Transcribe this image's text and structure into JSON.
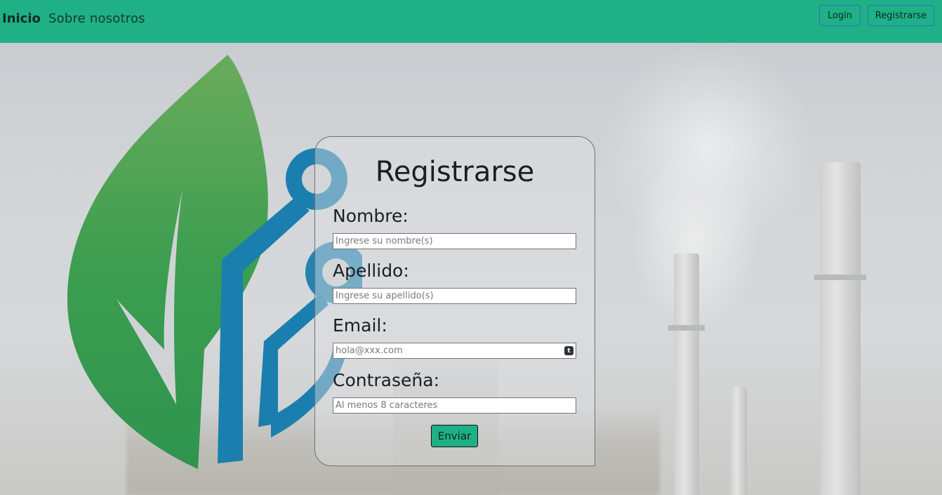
{
  "navbar": {
    "brand": "Inicio",
    "about_link": "Sobre nosotros",
    "login_label": "Login",
    "register_label": "Registrarse",
    "bg_color": "#1fb085"
  },
  "form": {
    "title": "Registrarse",
    "fields": [
      {
        "label": "Nombre:",
        "placeholder": "Ingrese su nombre(s)",
        "value": ""
      },
      {
        "label": "Apellido:",
        "placeholder": "Ingrese su apellido(s)",
        "value": ""
      },
      {
        "label": "Email:",
        "placeholder": "hola@xxx.com",
        "value": ""
      },
      {
        "label": "Contraseña:",
        "placeholder": "Al menos 8 caracteres",
        "value": ""
      }
    ],
    "email_icon_glyph": "t",
    "email_icon_name": "password-manager-icon",
    "submit_label": "Enviar"
  },
  "colors": {
    "accent": "#1fb085",
    "leaf_green": "#3d9e50",
    "circuit_blue": "#1a7fae"
  }
}
